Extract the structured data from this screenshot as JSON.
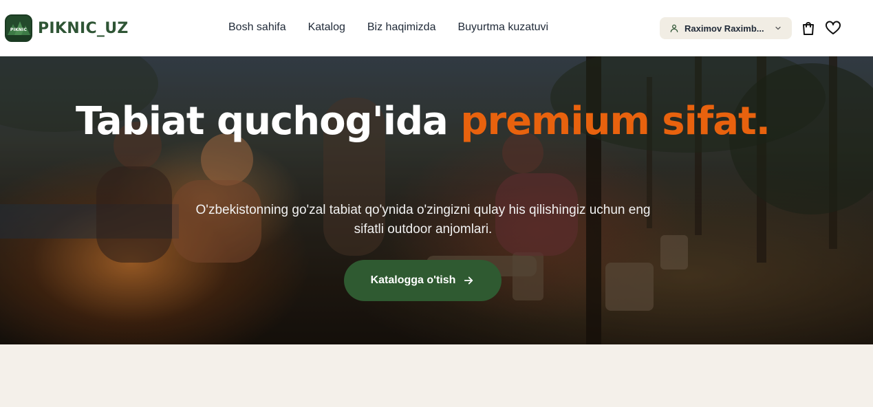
{
  "brand": {
    "logo_text": "PIKNIC",
    "name": "PIKNIC_UZ"
  },
  "nav": {
    "items": [
      {
        "label": "Bosh sahifa"
      },
      {
        "label": "Katalog"
      },
      {
        "label": "Biz haqimizda"
      },
      {
        "label": "Buyurtma kuzatuvi"
      }
    ]
  },
  "user": {
    "name": "Raximov Raximb..."
  },
  "icons": {
    "user": "user-icon",
    "chevron": "chevron-down-icon",
    "cart": "shopping-bag-icon",
    "wishlist": "heart-icon",
    "arrow": "arrow-right-icon"
  },
  "hero": {
    "title_main": "Tabiat quchog'ida",
    "title_accent": "premium sifat.",
    "subtitle": "O'zbekistonning go'zal tabiat qo'ynida o'zingizni qulay his qilishingiz uchun eng sifatli outdoor anjomlari.",
    "cta_label": "Katalogga o'tish"
  },
  "colors": {
    "brand_green": "#2f5535",
    "cta_green": "#2f5a31",
    "accent_orange": "#e8620e",
    "page_bg": "#f4f0ea",
    "user_pill_bg": "#f1ede4"
  }
}
